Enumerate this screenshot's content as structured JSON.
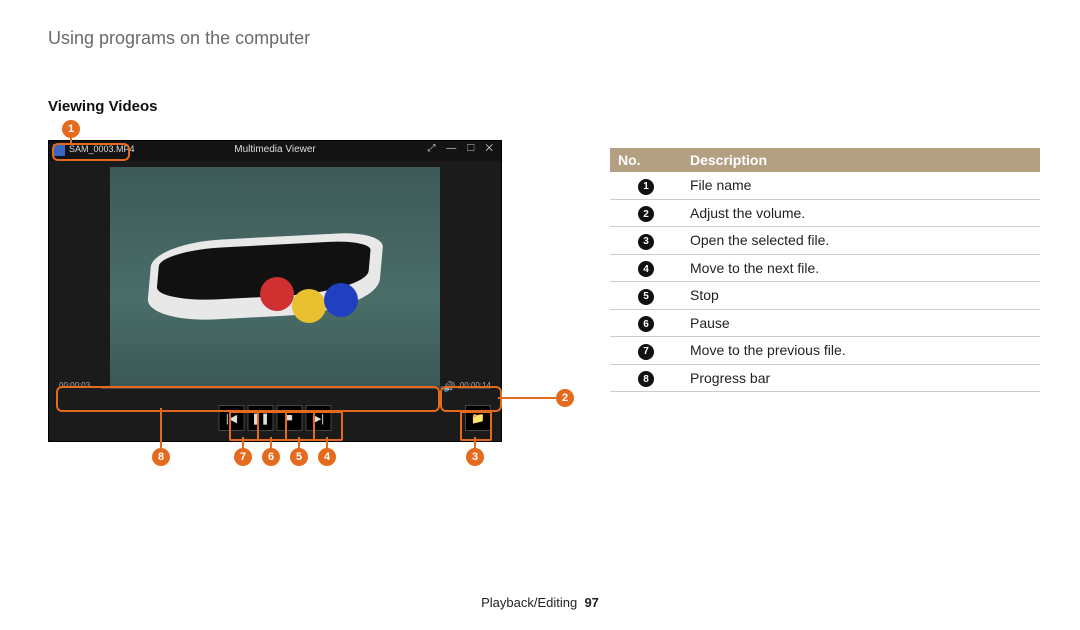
{
  "header": "Using programs on the computer",
  "section_title": "Viewing Videos",
  "player": {
    "app_title": "Multimedia Viewer",
    "file_name": "SAM_0003.MP4",
    "window_buttons": "⤢  —  ☐  ✕",
    "progress": {
      "current": "00:00:03",
      "total": "00:00:14"
    },
    "controls": {
      "previous": "|◀",
      "pause": "❚❚",
      "stop": "■",
      "next": "▶|",
      "open": "📁",
      "speaker": "🔊"
    }
  },
  "callouts": {
    "1": "1",
    "2": "2",
    "3": "3",
    "4": "4",
    "5": "5",
    "6": "6",
    "7": "7",
    "8": "8"
  },
  "table": {
    "head_no": "No.",
    "head_desc": "Description",
    "rows": [
      {
        "n": "1",
        "d": "File name"
      },
      {
        "n": "2",
        "d": "Adjust the volume."
      },
      {
        "n": "3",
        "d": "Open the selected file."
      },
      {
        "n": "4",
        "d": "Move to the next file."
      },
      {
        "n": "5",
        "d": "Stop"
      },
      {
        "n": "6",
        "d": "Pause"
      },
      {
        "n": "7",
        "d": "Move to the previous file."
      },
      {
        "n": "8",
        "d": "Progress bar"
      }
    ]
  },
  "footer": {
    "section": "Playback/Editing",
    "page": "97"
  }
}
